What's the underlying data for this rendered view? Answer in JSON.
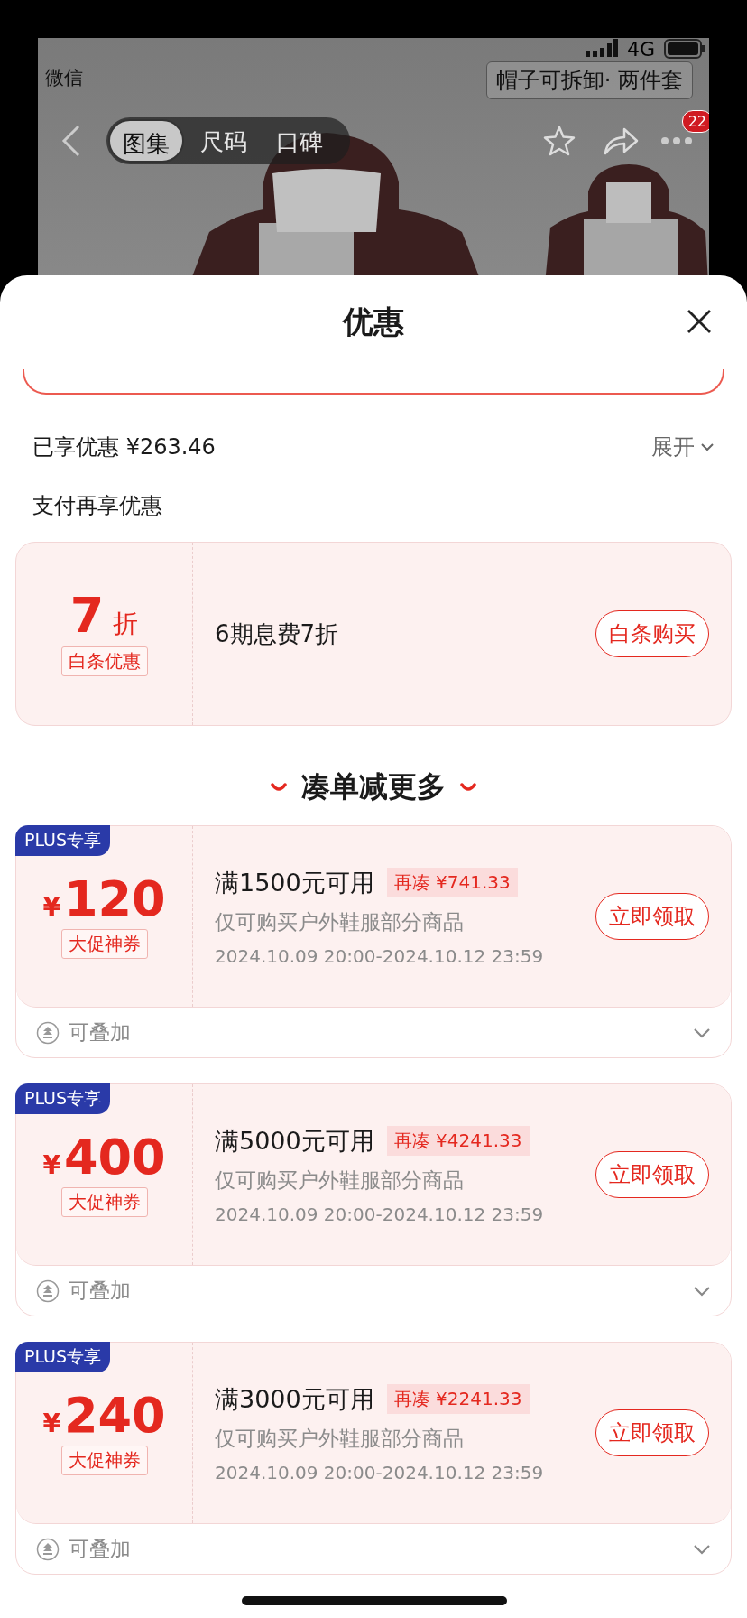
{
  "status_bar": {
    "back_app": "微信",
    "network": "4G"
  },
  "product_tag": "帽子可拆卸· 两件套",
  "nav": {
    "tabs": [
      {
        "label": "图集",
        "selected": true
      },
      {
        "label": "尺码",
        "selected": false
      },
      {
        "label": "口碑",
        "selected": false
      }
    ],
    "badge": "22"
  },
  "sheet": {
    "title": "优惠"
  },
  "enjoyed": {
    "label": "已享优惠 ¥263.46",
    "toggle": "展开"
  },
  "pay_section": {
    "title": "支付再享优惠",
    "card": {
      "discount": "7",
      "unit": "折",
      "tag": "白条优惠",
      "desc": "6期息费7折",
      "button": "白条购买"
    }
  },
  "more_section": {
    "title": "凑单减更多",
    "coupons": [
      {
        "badge": "PLUS专享",
        "currency": "¥",
        "amount": "120",
        "tag": "大促神券",
        "condition": "满1500元可用",
        "gap": "再凑 ¥741.33",
        "scope": "仅可购买户外鞋服部分商品",
        "period": "2024.10.09 20:00-2024.10.12 23:59",
        "button": "立即领取",
        "stack": "可叠加"
      },
      {
        "badge": "PLUS专享",
        "currency": "¥",
        "amount": "400",
        "tag": "大促神券",
        "condition": "满5000元可用",
        "gap": "再凑 ¥4241.33",
        "scope": "仅可购买户外鞋服部分商品",
        "period": "2024.10.09 20:00-2024.10.12 23:59",
        "button": "立即领取",
        "stack": "可叠加"
      },
      {
        "badge": "PLUS专享",
        "currency": "¥",
        "amount": "240",
        "tag": "大促神券",
        "condition": "满3000元可用",
        "gap": "再凑 ¥2241.33",
        "scope": "仅可购买户外鞋服部分商品",
        "period": "2024.10.09 20:00-2024.10.12 23:59",
        "button": "立即领取",
        "stack": "可叠加"
      }
    ]
  }
}
